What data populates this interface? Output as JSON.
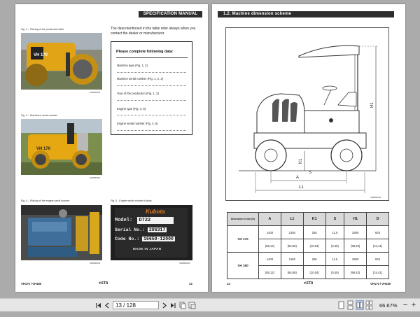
{
  "left_page": {
    "header": "SPECIFICATION MANUAL",
    "fig2_caption": "Fig. 2 – Placing of the production label",
    "fig3_caption": "Fig. 3 – Machine's serial number",
    "fig4_caption": "Fig. 4 – Placing of the engine serial number",
    "fig5_caption": "Fig. 5 - Engine serial number Kubota",
    "code1": "S06880001",
    "code2": "S06880002",
    "code3": "S06880003",
    "code4": "S06880004",
    "intro_line1": "The data mentioned in the table refer always when you",
    "intro_line2": "contact the dealer or manufacturer.",
    "form": {
      "title": "Please complete following data:",
      "fields": [
        "Machine type (Fig. 1, 2)",
        "Machine serial number (Fig. 1, 2, 3)",
        "Year of the production (Fig. 1, 2)",
        "Engine type (Fig. 4, 5)",
        "Engine serial number (Fig. 4, 5)"
      ]
    },
    "plate": {
      "brand": "Kubota",
      "model_label": "Model:",
      "model_value": "D722",
      "serial_label": "Serial No.:",
      "serial_value": "2U6317",
      "code_label": "Code No.:",
      "code_value": "16659-12000",
      "made_in": "MADE IN JAPAN"
    },
    "footer_left": "VH170 / VH180",
    "logo": "STA",
    "page_number": "13"
  },
  "right_page": {
    "header": "1.2.  Machine dimension scheme",
    "diagram_labels": {
      "H1": "H1",
      "K1": "K1",
      "S": "S",
      "A": "A",
      "L1": "L1"
    },
    "diagram_code": "S06880003",
    "table": {
      "corner_label": "Dimensions in mm (in)",
      "headers": [
        "A",
        "L1",
        "K1",
        "S",
        "H1",
        "D"
      ],
      "rows": [
        {
          "model": "VH 170",
          "mm": [
            "1400",
            "2150",
            "255",
            "11,5",
            "2500",
            "620"
          ],
          "inches": [
            "(55,12)",
            "(84,65)",
            "(10,04)",
            "(0,45)",
            "(98,43)",
            "(24,41)"
          ]
        },
        {
          "model": "VH 180",
          "mm": [
            "1400",
            "2150",
            "255",
            "11,5",
            "2500",
            "820"
          ],
          "inches": [
            "(55,12)",
            "(84,65)",
            "(10,04)",
            "(0,45)",
            "(98,43)",
            "(24,41)"
          ]
        }
      ]
    },
    "page_number": "14",
    "logo": "STA",
    "footer_right": "VH170 / VH180"
  },
  "toolbar": {
    "page_input": "13 / 128",
    "zoom": "66.67%",
    "first_icon": "first-page-icon",
    "prev_icon": "prev-page-icon",
    "next_icon": "next-page-icon",
    "last_icon": "last-page-icon",
    "zoom_out_icon": "minus-icon",
    "zoom_in_icon": "plus-icon"
  }
}
